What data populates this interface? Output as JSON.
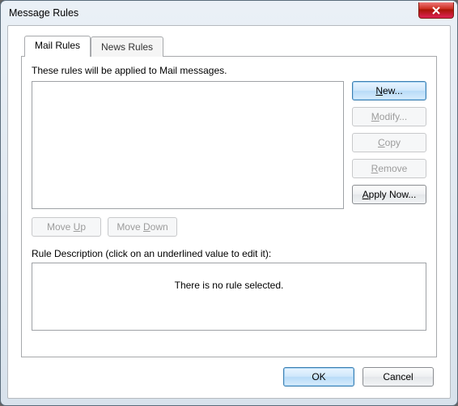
{
  "window": {
    "title": "Message Rules"
  },
  "tabs": {
    "mail": "Mail Rules",
    "news": "News Rules"
  },
  "panel": {
    "apply_text": "These rules will be applied to Mail messages.",
    "desc_label": "Rule Description (click on an underlined value to edit it):",
    "no_rule": "There is no rule selected."
  },
  "buttons": {
    "new": "New...",
    "modify": "Modify...",
    "copy": "Copy",
    "remove": "Remove",
    "apply_now": "Apply Now...",
    "move_up": "Move Up",
    "move_down": "Move Down",
    "ok": "OK",
    "cancel": "Cancel"
  }
}
